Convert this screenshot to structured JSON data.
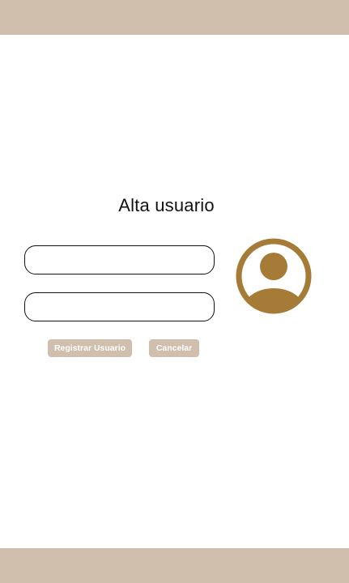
{
  "colors": {
    "bar": "#d0bfad",
    "accent": "#a57b37",
    "button": "#d0bfad"
  },
  "header": {},
  "form": {
    "title": "Alta usuario",
    "field_1": {
      "value": "",
      "placeholder": ""
    },
    "field_2": {
      "value": "",
      "placeholder": ""
    },
    "register_label": "Registrar Usuario",
    "cancel_label": "Cancelar",
    "avatar_icon": "user-avatar-icon"
  },
  "footer": {}
}
